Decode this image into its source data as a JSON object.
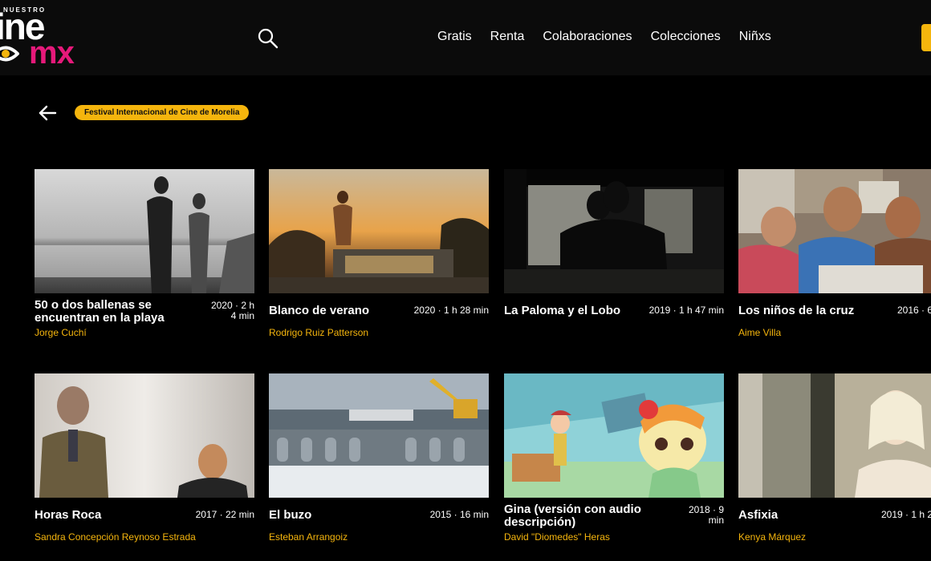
{
  "header": {
    "logo_small": "NUESTRO",
    "logo_main": "ine",
    "logo_sub": "mx",
    "nav": [
      "Gratis",
      "Renta",
      "Colaboraciones",
      "Colecciones",
      "Niñxs"
    ]
  },
  "collection": {
    "name": "Festival Internacional de Cine de Morelia"
  },
  "films": [
    {
      "title": "50 o dos ballenas se encuentran en la playa",
      "meta": "2020 · 2 h 4 min",
      "director": "Jorge Cuchí"
    },
    {
      "title": "Blanco de verano",
      "meta": "2020 · 1 h 28 min",
      "director": "Rodrigo Ruiz Patterson"
    },
    {
      "title": "La Paloma y el Lobo",
      "meta": "2019 · 1 h 47 min",
      "director": ""
    },
    {
      "title": "Los niños de la cruz",
      "meta": "2016 · 6",
      "director": "Aime Villa"
    },
    {
      "title": "Horas Roca",
      "meta": "2017 · 22 min",
      "director": "Sandra Concepción Reynoso Estrada"
    },
    {
      "title": "El buzo",
      "meta": "2015 · 16 min",
      "director": "Esteban Arrangoiz"
    },
    {
      "title": "Gina (versión con audio descripción)",
      "meta": "2018 · 9 min",
      "director": "David \"Diomedes\" Heras"
    },
    {
      "title": "Asfixia",
      "meta": "2019 · 1 h 2",
      "director": "Kenya Márquez"
    }
  ],
  "colors": {
    "accent": "#f5b50d",
    "brand_pink": "#e6197a",
    "background": "#000000"
  }
}
